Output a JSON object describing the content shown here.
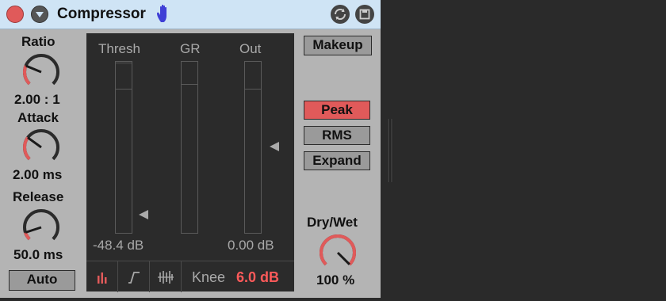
{
  "device": {
    "title": "Compressor",
    "icons": [
      "close-icon",
      "fold-icon",
      "hand-icon",
      "hot-swap-icon",
      "save-icon"
    ]
  },
  "knobs": {
    "ratio": {
      "label": "Ratio",
      "value": "2.00 : 1",
      "level": 0.25
    },
    "attack": {
      "label": "Attack",
      "value": "2.00 ms",
      "level": 0.3
    },
    "release": {
      "label": "Release",
      "value": "50.0 ms",
      "level": 0.1
    },
    "drywet": {
      "label": "Dry/Wet",
      "value": "100 %",
      "level": 1.0
    }
  },
  "auto_button": "Auto",
  "meters": {
    "thresh": {
      "label": "Thresh",
      "value": "-48.4 dB"
    },
    "gr": {
      "label": "GR"
    },
    "out": {
      "label": "Out",
      "value": "0.00 dB"
    }
  },
  "knee": {
    "label": "Knee",
    "value": "6.0 dB"
  },
  "buttons": {
    "makeup": "Makeup",
    "peak": "Peak",
    "rms": "RMS",
    "expand": "Expand"
  },
  "view_tabs": [
    "collapsed-view-icon",
    "transfer-curve-icon",
    "activity-view-icon"
  ],
  "colors": {
    "title_bar": "#cfe4f5",
    "device_bg": "#b4b4b4",
    "knob_accent": "#e05a5a",
    "active_button": "#e05a5a",
    "meter_panel": "#2b2b2b",
    "knee_value": "#ff5a5a",
    "background": "#2a2a2a"
  }
}
